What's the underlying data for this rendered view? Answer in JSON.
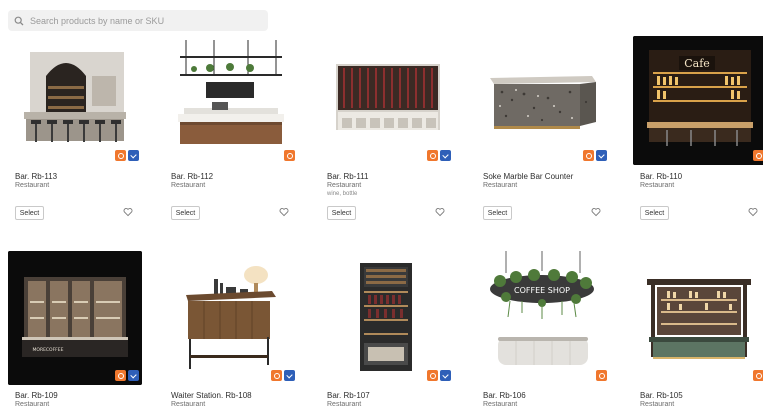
{
  "search": {
    "placeholder": "Search products by name or SKU"
  },
  "select_label": "Select",
  "products": [
    {
      "name": "Bar. Rb-113",
      "category": "Restaurant",
      "extra": "",
      "badges": [
        "orange",
        "blue"
      ],
      "dark": false
    },
    {
      "name": "Bar. Rb-112",
      "category": "Restaurant",
      "extra": "",
      "badges": [
        "orange"
      ],
      "dark": false
    },
    {
      "name": "Bar. Rb-111",
      "category": "Restaurant",
      "extra": "wine, bottle",
      "badges": [
        "orange",
        "blue"
      ],
      "dark": false
    },
    {
      "name": "Soke Marble Bar Counter",
      "category": "Restaurant",
      "extra": "",
      "badges": [
        "orange",
        "blue"
      ],
      "dark": false
    },
    {
      "name": "Bar. Rb-110",
      "category": "Restaurant",
      "extra": "",
      "badges": [
        "orange"
      ],
      "dark": true,
      "sign": "Cafe"
    },
    {
      "name": "Bar. Rb-109",
      "category": "Restaurant",
      "extra": "",
      "badges": [
        "orange",
        "blue"
      ],
      "dark": true,
      "sign": "MORECOFFEE"
    },
    {
      "name": "Waiter Station. Rb-108",
      "category": "Restaurant",
      "extra": "",
      "badges": [
        "orange",
        "blue"
      ],
      "dark": false
    },
    {
      "name": "Bar. Rb-107",
      "category": "Restaurant",
      "extra": "",
      "badges": [
        "orange",
        "blue"
      ],
      "dark": false
    },
    {
      "name": "Bar. Rb-106",
      "category": "Restaurant",
      "extra": "",
      "badges": [
        "orange"
      ],
      "dark": false,
      "sign": "COFFEE SHOP"
    },
    {
      "name": "Bar. Rb-105",
      "category": "Restaurant",
      "extra": "",
      "badges": [
        "orange"
      ],
      "dark": false
    }
  ],
  "icons": {
    "search": "search-icon",
    "favorite": "heart-icon"
  },
  "colors": {
    "badge_orange": "#f0772d",
    "badge_blue": "#2e5fb8"
  }
}
